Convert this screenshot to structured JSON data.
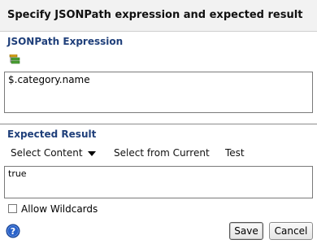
{
  "dialog": {
    "title": "Specify JSONPath expression and expected result"
  },
  "expression_section": {
    "header": "JSONPath Expression",
    "tree_icon": "tree-structure-icon",
    "value": "$.category.name"
  },
  "result_section": {
    "header": "Expected Result",
    "toolbar": {
      "select_content": "Select Content",
      "select_from_current": "Select from Current",
      "test": "Test"
    },
    "value": "true",
    "allow_wildcards_label": "Allow Wildcards",
    "allow_wildcards_checked": false
  },
  "footer": {
    "help_icon": "help-icon",
    "save_label": "Save",
    "cancel_label": "Cancel"
  },
  "colors": {
    "section_header": "#1f3f7a",
    "title_bar": "#f2f2f2",
    "help_icon": "#2a62c9"
  }
}
